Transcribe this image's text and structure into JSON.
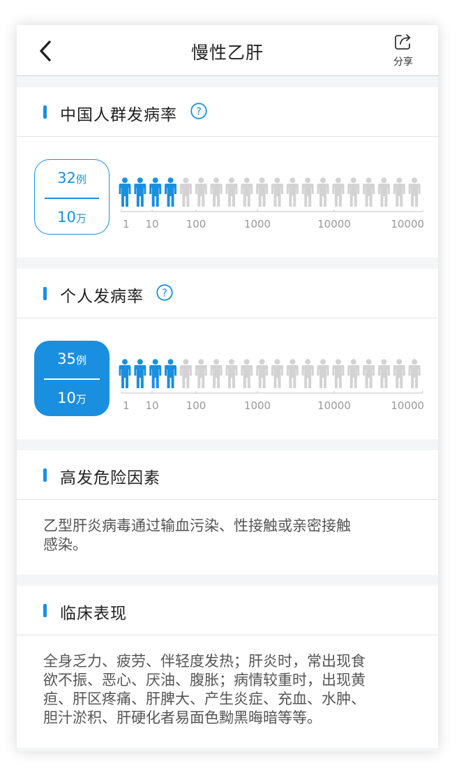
{
  "header": {
    "title": "慢性乙肝",
    "share_label": "分享"
  },
  "population": {
    "title": "中国人群发病率",
    "rate_number": "32",
    "rate_unit": "例",
    "rate_base_number": "10",
    "rate_base_unit": "万",
    "highlighted_figures": 4,
    "total_figures": 20
  },
  "personal": {
    "title": "个人发病率",
    "rate_number": "35",
    "rate_unit": "例",
    "rate_base_number": "10",
    "rate_base_unit": "万",
    "highlighted_figures": 4,
    "total_figures": 20
  },
  "scale_labels": [
    "1",
    "10",
    "100",
    "1000",
    "10000",
    "100000"
  ],
  "risk_factors": {
    "title": "高发危险因素",
    "lines": [
      "乙型肝炎病毒通过输血污染、性接触或亲密接触",
      "感染。"
    ]
  },
  "clinical": {
    "title": "临床表现",
    "lines": [
      "全身乏力、疲劳、伴轻度发热；肝炎时，常出现食",
      "欲不振、恶心、厌油、腹胀；病情较重时，出现黄",
      "疸、肝区疼痛、肝脾大、产生炎症、充血、水肿、",
      "胆汁淤积、肝硬化者易面色黝黑晦暗等等。"
    ]
  },
  "colors": {
    "accent": "#1a8fe0",
    "inactive_figure": "#d3d3d3"
  },
  "icons": {
    "back": "chevron-left-icon",
    "share": "share-icon",
    "help": "question-circle-icon"
  }
}
